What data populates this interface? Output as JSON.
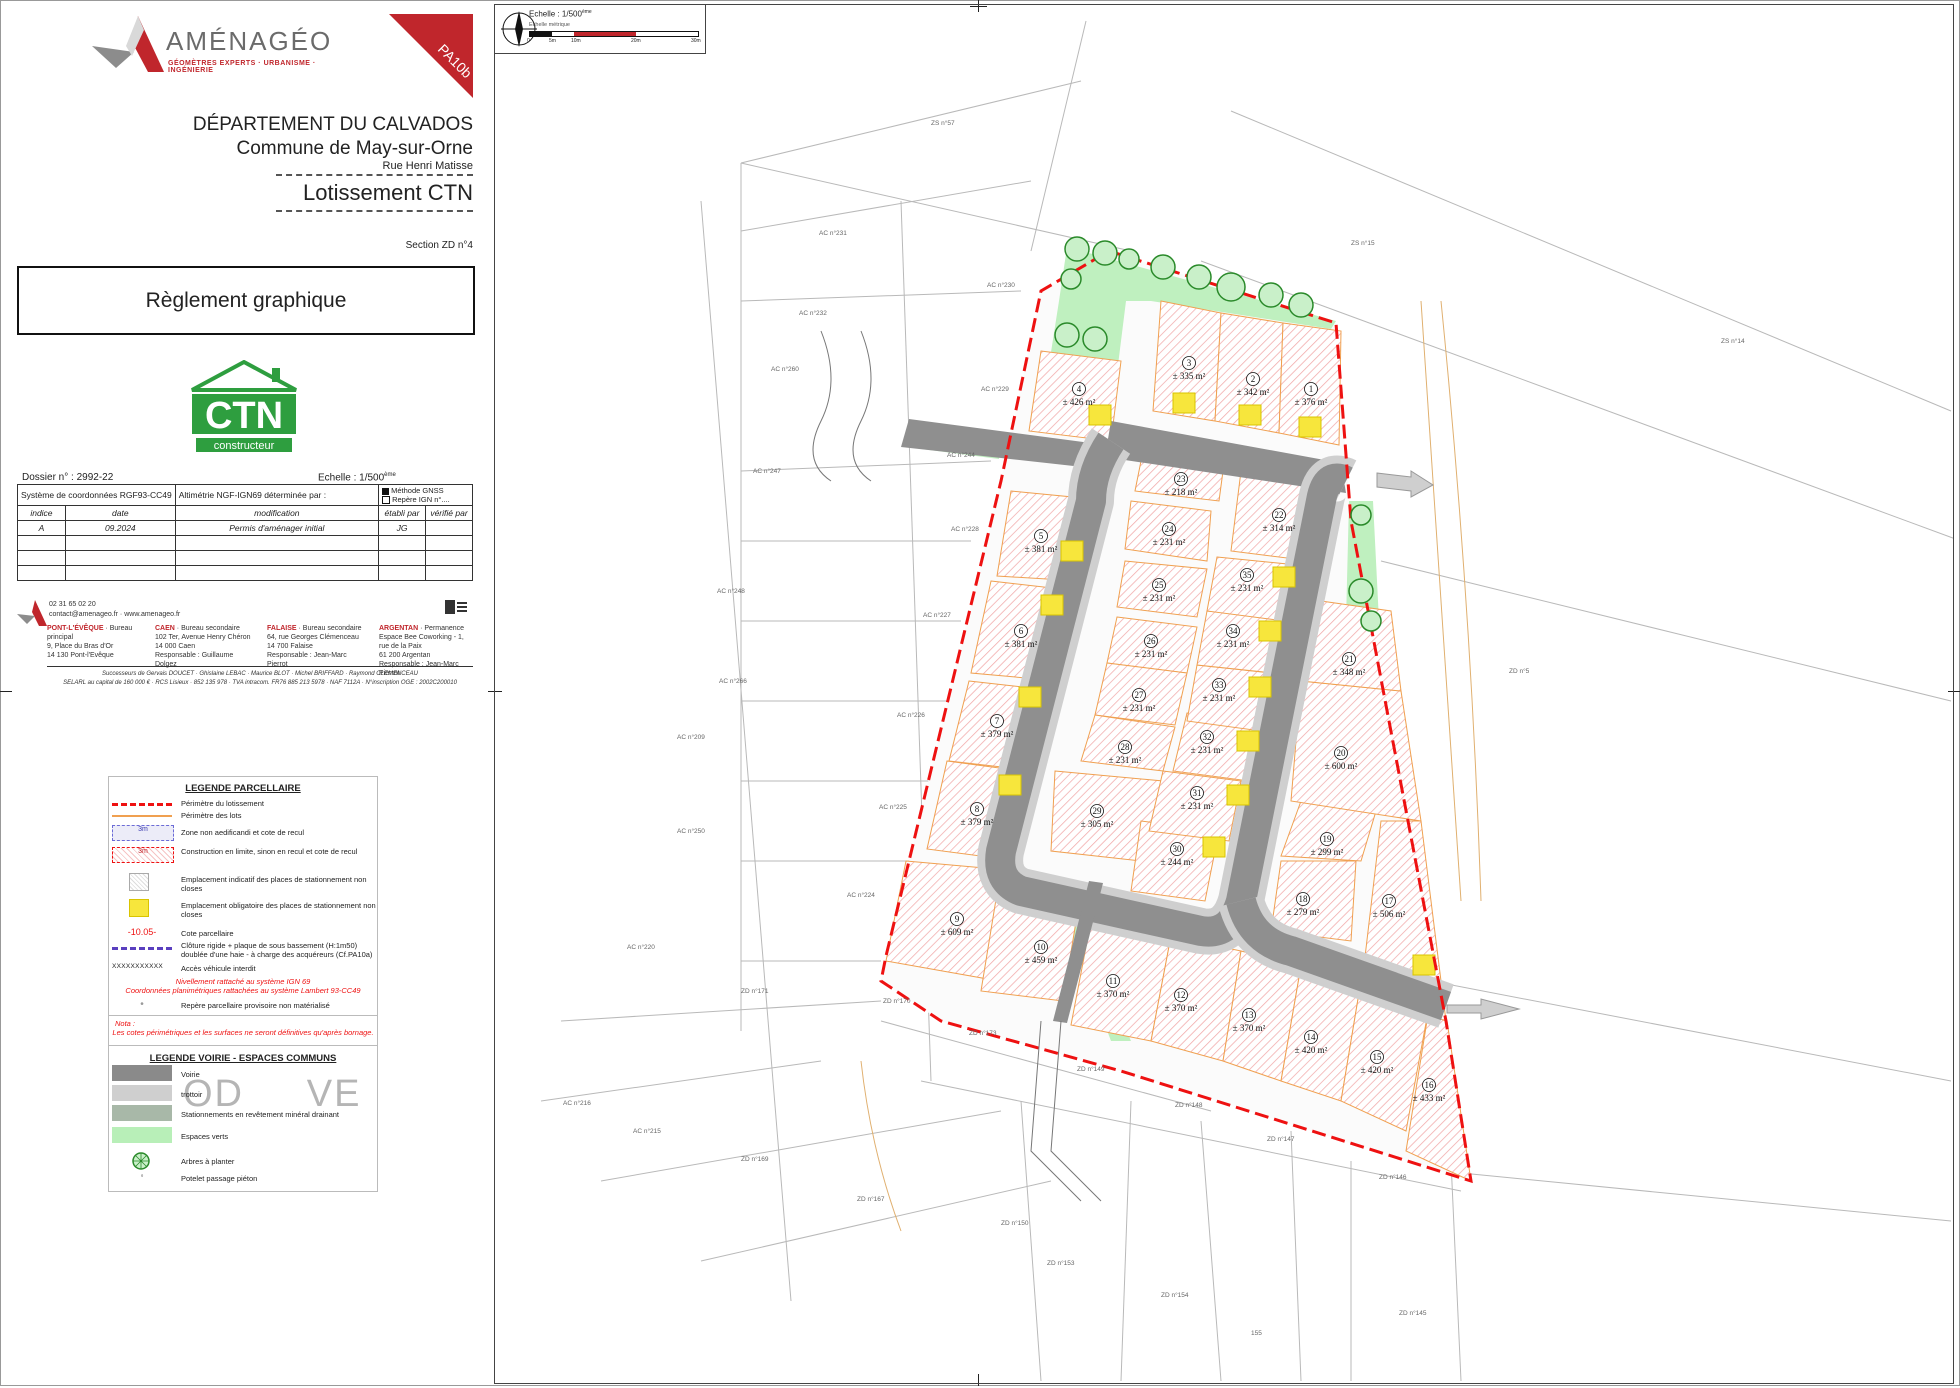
{
  "company": {
    "name": "AMÉNAGÉO",
    "tagline": "GÉOMÈTRES EXPERTS · URBANISME · INGÉNIERIE",
    "phone": "02 31 65 02 20",
    "email": "contact@amenageo.fr",
    "website": "www.amenageo.fr",
    "brand_color": "#c0262c"
  },
  "document": {
    "piece": "PA10b",
    "department": "DÉPARTEMENT DU CALVADOS",
    "commune": "Commune de May-sur-Orne",
    "street": "Rue Henri Matisse",
    "project": "Lotissement CTN",
    "section": "Section ZD n°4",
    "title": "Règlement graphique",
    "client_logo": {
      "name": "CTN",
      "sub": "constructeur",
      "color": "#2e9e3f"
    }
  },
  "info_table": {
    "dossier": "Dossier n° : 2992-22",
    "scale": "Echelle : 1/500",
    "scale_sup": "ème",
    "coords": "Système de coordonnées RGF93-CC49",
    "altimetry": "Altimétrie NGF-IGN69 déterminée par :",
    "method1": "Méthode GNSS",
    "method2": "Repère IGN n°....",
    "headers": [
      "indice",
      "date",
      "modification",
      "établi par",
      "vérifié par"
    ],
    "rows": [
      {
        "indice": "A",
        "date": "09.2024",
        "modification": "Permis d'aménager initial",
        "etabli": "JG",
        "verifie": ""
      }
    ]
  },
  "offices": [
    {
      "city": "PONT-L'ÉVÊQUE",
      "lines": [
        "Bureau principal",
        "9, Place du Bras d'Or",
        "14 130 Pont-l'Evêque"
      ]
    },
    {
      "city": "CAEN",
      "lines": [
        "Bureau secondaire",
        "102 Ter, Avenue Henry Chéron",
        "14 000 Caen",
        "Responsable : Guillaume Dolgez"
      ]
    },
    {
      "city": "FALAISE",
      "lines": [
        "Bureau secondaire",
        "64, rue Georges Clémenceau",
        "14 700 Falaise",
        "Responsable : Jean-Marc Pierrot"
      ]
    },
    {
      "city": "ARGENTAN",
      "lines": [
        "Permanence",
        "Espace Bee Coworking - 1, rue de la Paix",
        "61 200 Argentan",
        "Responsable : Jean-Marc Pierrot"
      ]
    }
  ],
  "footer": {
    "successors": "Successeurs de Gervais DOUCET · Ghislaine LEBAC · Maurice BLOT · Michel BRIFFARD · Raymond CLEMENCEAU",
    "legal": "SELARL au capital de 160 000 € · RCS Lisieux · 852 135 978 · TVA intracom. FR76 885 213 5978 · NAF 7112A · N°inscription OGE : 2002C200010"
  },
  "scalebar": {
    "label": "Echelle : 1/500",
    "sup": "ème",
    "graphic": "Echelle métrique",
    "ticks": [
      "0",
      "5m",
      "10m",
      "20m",
      "30m"
    ]
  },
  "legend_parcel": {
    "title": "LEGENDE PARCELLAIRE",
    "items": [
      "Périmètre du lotissement",
      "Périmètre des lots",
      "Zone non aedificandi et cote de recul",
      "Construction en limite, sinon en recul et cote de recul",
      "Emplacement indicatif des places de stationnement non closes",
      "Emplacement obligatoire des places de stationnement non closes",
      "Cote parcellaire",
      "Clôture rigide + plaque de sous bassement (H:1m50) doublée d'une haie - à charge des acquéreurs (Cf.PA10a)",
      "Accès véhicule interdit",
      "Repère parcellaire provisoire non matérialisé"
    ],
    "sym_3m": "3m",
    "sym_cote": "-10.05-",
    "sym_access": "XXXXXXXXXXX",
    "note_red": [
      "Nivellement rattaché au système IGN 69",
      "Coordonnées planimétriques rattachées au système Lambert 93-CC49"
    ],
    "nota_title": "Nota :",
    "nota_text": "Les cotes périmétriques et les surfaces ne seront définitives qu'après bornage."
  },
  "legend_road": {
    "title": "LEGENDE VOIRIE - ESPACES COMMUNS",
    "items": [
      "Voirie",
      "trottoir",
      "Stationnements en revêtement minéral drainant",
      "Espaces verts",
      "Arbres à planter",
      "Potelet passage piéton"
    ],
    "watermark": "OD     VE"
  },
  "lots": [
    {
      "n": "1",
      "area": "± 376 m²"
    },
    {
      "n": "2",
      "area": "± 342 m²"
    },
    {
      "n": "3",
      "area": "± 335 m²"
    },
    {
      "n": "4",
      "area": "± 426 m²"
    },
    {
      "n": "5",
      "area": "± 381 m²"
    },
    {
      "n": "6",
      "area": "± 381 m²"
    },
    {
      "n": "7",
      "area": "± 379 m²"
    },
    {
      "n": "8",
      "area": "± 379 m²"
    },
    {
      "n": "9",
      "area": "± 609 m²"
    },
    {
      "n": "10",
      "area": "± 459 m²"
    },
    {
      "n": "11",
      "area": "± 370 m²"
    },
    {
      "n": "12",
      "area": "± 370 m²"
    },
    {
      "n": "13",
      "area": "± 370 m²"
    },
    {
      "n": "14",
      "area": "± 420 m²"
    },
    {
      "n": "15",
      "area": "± 420 m²"
    },
    {
      "n": "16",
      "area": "± 433 m²"
    },
    {
      "n": "17",
      "area": "± 506 m²"
    },
    {
      "n": "18",
      "area": "± 279 m²"
    },
    {
      "n": "19",
      "area": "± 299 m²"
    },
    {
      "n": "20",
      "area": "± 600 m²"
    },
    {
      "n": "21",
      "area": "± 348 m²"
    },
    {
      "n": "22",
      "area": "± 314 m²"
    },
    {
      "n": "23",
      "area": "± 218 m²"
    },
    {
      "n": "24",
      "area": "± 231 m²"
    },
    {
      "n": "25",
      "area": "± 231 m²"
    },
    {
      "n": "26",
      "area": "± 231 m²"
    },
    {
      "n": "27",
      "area": "± 231 m²"
    },
    {
      "n": "28",
      "area": "± 231 m²"
    },
    {
      "n": "29",
      "area": "± 305 m²"
    },
    {
      "n": "30",
      "area": "± 244 m²"
    },
    {
      "n": "31",
      "area": "± 231 m²"
    },
    {
      "n": "32",
      "area": "± 231 m²"
    },
    {
      "n": "33",
      "area": "± 231 m²"
    },
    {
      "n": "34",
      "area": "± 231 m²"
    },
    {
      "n": "35",
      "area": "± 231 m²"
    }
  ],
  "cadastre_labels": [
    "ZS n°57",
    "ZS n°15",
    "ZS n°14",
    "AC n°231",
    "AC n°230",
    "AC n°232",
    "AC n°260",
    "AC n°229",
    "AC n°247",
    "AC n°244",
    "AC n°228",
    "AC n°248",
    "AC n°227",
    "AC n°266",
    "AC n°226",
    "AC n°209",
    "AC n°225",
    "AC n°250",
    "AC n°224",
    "AC n°220",
    "ZD n°5",
    "ZD n°171",
    "ZD n°170",
    "ZD n°173",
    "ZD n°149",
    "ZD n°148",
    "ZD n°147",
    "ZD n°146",
    "AC n°216",
    "AC n°215",
    "ZD n°169",
    "ZD n°167",
    "ZD n°150",
    "ZD n°153",
    "ZD n°154",
    "ZD n°145",
    "155"
  ]
}
